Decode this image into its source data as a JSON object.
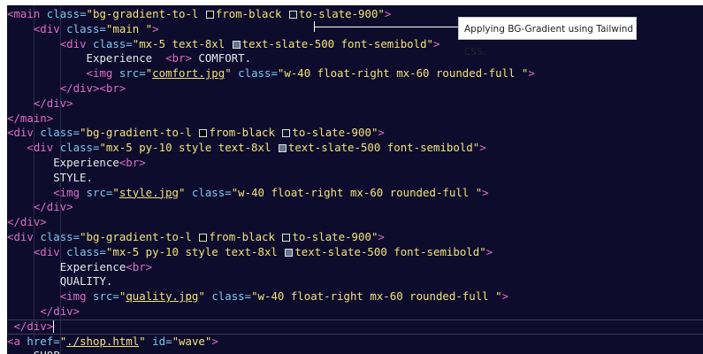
{
  "tooltip": {
    "text": "Applying BG-Gradient using Tailwind CSS."
  },
  "code": {
    "lines": [
      {
        "indent": "",
        "tokens": [
          [
            "tag",
            "<main"
          ],
          [
            "sp",
            " "
          ],
          [
            "attr",
            "class="
          ],
          [
            "str",
            "\"bg-gradient-to-l "
          ],
          [
            "sw",
            "#000000"
          ],
          [
            "str",
            "from-black "
          ],
          [
            "sw",
            "#0f172a"
          ],
          [
            "str",
            "to-slate-900\""
          ],
          [
            "tag",
            ">"
          ]
        ]
      },
      {
        "indent": "    ",
        "tokens": [
          [
            "tag",
            "<div"
          ],
          [
            "sp",
            " "
          ],
          [
            "attr",
            "class="
          ],
          [
            "str",
            "\"main \""
          ],
          [
            "tag",
            ">"
          ]
        ]
      },
      {
        "indent": "        ",
        "tokens": [
          [
            "tag",
            "<div"
          ],
          [
            "sp",
            " "
          ],
          [
            "attr",
            "class="
          ],
          [
            "str",
            "\"mx-5 text-8xl "
          ],
          [
            "sw",
            "#64748b"
          ],
          [
            "str",
            "text-slate-500 font-semibold\""
          ],
          [
            "tag",
            ">"
          ]
        ]
      },
      {
        "indent": "            ",
        "tokens": [
          [
            "text",
            "Experience  "
          ],
          [
            "tag",
            "<br>"
          ],
          [
            "text",
            " COMFORT."
          ]
        ]
      },
      {
        "indent": "            ",
        "tokens": [
          [
            "tag",
            "<img"
          ],
          [
            "sp",
            " "
          ],
          [
            "attr",
            "src="
          ],
          [
            "str",
            "\""
          ],
          [
            "link",
            "comfort.jpg"
          ],
          [
            "str",
            "\""
          ],
          [
            "sp",
            " "
          ],
          [
            "attr",
            "class="
          ],
          [
            "str",
            "\"w-40 float-right mx-60 rounded-full \""
          ],
          [
            "tag",
            ">"
          ]
        ]
      },
      {
        "indent": "        ",
        "tokens": [
          [
            "tag",
            "</div>"
          ],
          [
            "tag",
            "<br>"
          ]
        ]
      },
      {
        "indent": "    ",
        "tokens": [
          [
            "tag",
            "</div>"
          ]
        ]
      },
      {
        "indent": "",
        "tokens": [
          [
            "tag",
            "</main>"
          ]
        ]
      },
      {
        "indent": "",
        "tokens": [
          [
            "tag",
            "<div"
          ],
          [
            "sp",
            " "
          ],
          [
            "attr",
            "class="
          ],
          [
            "str",
            "\"bg-gradient-to-l "
          ],
          [
            "sw",
            "#000000"
          ],
          [
            "str",
            "from-black "
          ],
          [
            "sw",
            "#0f172a"
          ],
          [
            "str",
            "to-slate-900\""
          ],
          [
            "tag",
            ">"
          ]
        ]
      },
      {
        "indent": "   ",
        "tokens": [
          [
            "tag",
            "<div"
          ],
          [
            "sp",
            " "
          ],
          [
            "attr",
            "class="
          ],
          [
            "str",
            "\"mx-5 py-10 style text-8xl "
          ],
          [
            "sw",
            "#64748b"
          ],
          [
            "str",
            "text-slate-500 font-semibold\""
          ],
          [
            "tag",
            ">"
          ]
        ]
      },
      {
        "indent": "       ",
        "tokens": [
          [
            "text",
            "Experience"
          ],
          [
            "tag",
            "<br>"
          ]
        ]
      },
      {
        "indent": "       ",
        "tokens": [
          [
            "text",
            "STYLE."
          ]
        ]
      },
      {
        "indent": "       ",
        "tokens": [
          [
            "tag",
            "<img"
          ],
          [
            "sp",
            " "
          ],
          [
            "attr",
            "src="
          ],
          [
            "str",
            "\""
          ],
          [
            "link",
            "style.jpg"
          ],
          [
            "str",
            "\""
          ],
          [
            "sp",
            " "
          ],
          [
            "attr",
            "class="
          ],
          [
            "str",
            "\"w-40 float-right mx-60 rounded-full \""
          ],
          [
            "tag",
            ">"
          ]
        ]
      },
      {
        "indent": "    ",
        "tokens": [
          [
            "tag",
            "</div>"
          ]
        ]
      },
      {
        "indent": "",
        "tokens": [
          [
            "tag",
            "</div>"
          ]
        ]
      },
      {
        "indent": "",
        "tokens": [
          [
            "tag",
            "<div"
          ],
          [
            "sp",
            " "
          ],
          [
            "attr",
            "class="
          ],
          [
            "str",
            "\"bg-gradient-to-l "
          ],
          [
            "sw",
            "#000000"
          ],
          [
            "str",
            "from-black "
          ],
          [
            "sw",
            "#0f172a"
          ],
          [
            "str",
            "to-slate-900\""
          ],
          [
            "tag",
            ">"
          ]
        ]
      },
      {
        "indent": "    ",
        "tokens": [
          [
            "tag",
            "<div"
          ],
          [
            "sp",
            " "
          ],
          [
            "attr",
            "class="
          ],
          [
            "str",
            "\"mx-5 py-10 style text-8xl "
          ],
          [
            "sw",
            "#64748b"
          ],
          [
            "str",
            "text-slate-500 font-semibold\""
          ],
          [
            "tag",
            ">"
          ]
        ]
      },
      {
        "indent": "        ",
        "tokens": [
          [
            "text",
            "Experience"
          ],
          [
            "tag",
            "<br>"
          ]
        ]
      },
      {
        "indent": "        ",
        "tokens": [
          [
            "text",
            "QUALITY."
          ]
        ]
      },
      {
        "indent": "        ",
        "tokens": [
          [
            "tag",
            "<img"
          ],
          [
            "sp",
            " "
          ],
          [
            "attr",
            "src="
          ],
          [
            "str",
            "\""
          ],
          [
            "link",
            "quality.jpg"
          ],
          [
            "str",
            "\""
          ],
          [
            "sp",
            " "
          ],
          [
            "attr",
            "class="
          ],
          [
            "str",
            "\"w-40 float-right mx-60 rounded-full \""
          ],
          [
            "tag",
            ">"
          ]
        ]
      },
      {
        "indent": "     ",
        "tokens": [
          [
            "tag",
            "</div>"
          ]
        ]
      },
      {
        "indent": " ",
        "tokens": [
          [
            "tag",
            "</div>"
          ]
        ],
        "cursor": true
      },
      {
        "indent": "",
        "tokens": [
          [
            "tag",
            "<a"
          ],
          [
            "sp",
            " "
          ],
          [
            "attr",
            "href="
          ],
          [
            "str",
            "\""
          ],
          [
            "link",
            "./shop.html"
          ],
          [
            "str",
            "\""
          ],
          [
            "sp",
            " "
          ],
          [
            "attr",
            "id="
          ],
          [
            "str",
            "\"wave\""
          ],
          [
            "tag",
            ">"
          ]
        ]
      },
      {
        "indent": "    ",
        "tokens": [
          [
            "text",
            "SHOP"
          ]
        ]
      }
    ]
  },
  "colors": {
    "editor_bg": "#0d0c2c",
    "tag": "#e06cc6",
    "attr": "#7ec8f0",
    "string": "#f2e27a",
    "text": "#e8e8e8"
  }
}
